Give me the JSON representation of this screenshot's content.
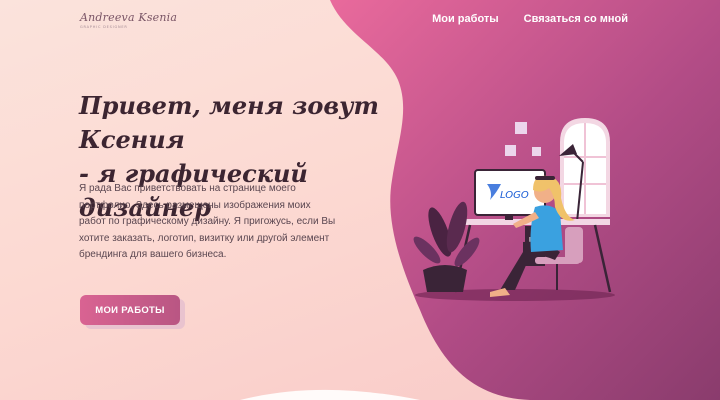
{
  "logo": {
    "script": "Andreeva Ksenia",
    "tagline": "graphic designer"
  },
  "nav": {
    "items": [
      {
        "label": "Мои работы"
      },
      {
        "label": "Связаться со мной"
      }
    ]
  },
  "hero": {
    "headline_line1": "Привет, меня зовут Ксения",
    "headline_line2": "- я графический дизайнер",
    "intro": "Я рада Вас приветствовать на странице моего портфолио. Здесь размещены изображения моих работ по графическому дизайну. Я пригожусь, если Вы хотите заказать, логотип, визитку или другой элемент брендинга для вашего бизнеса.",
    "cta_label": "МОИ РАБОТЫ"
  },
  "illustration": {
    "monitor_text": "LOGO"
  },
  "colors": {
    "accent": "#d96392",
    "blob_start": "#e56a99",
    "blob_end": "#8b2f66",
    "text_dark": "#3c2531"
  }
}
